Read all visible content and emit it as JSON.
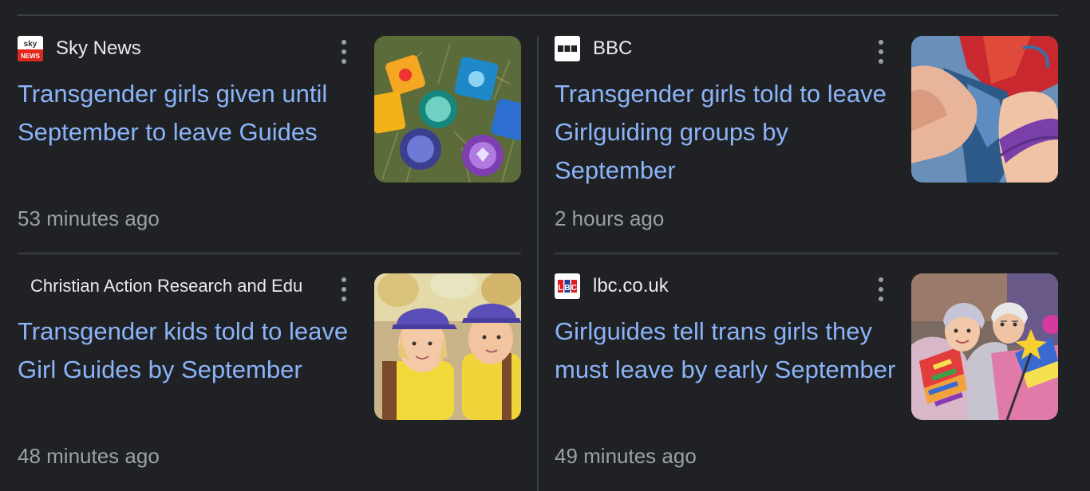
{
  "articles": [
    {
      "source": "Sky News",
      "favicon": "sky-news-icon",
      "headline": "Transgender girls given until September to leave Guides",
      "time": "53 minutes ago",
      "thumbnail": "guide-badges-on-grass"
    },
    {
      "source": "BBC",
      "favicon": "bbc-icon",
      "headline": "Transgender girls told to leave Girlguiding groups by September",
      "time": "2 hours ago",
      "thumbnail": "hands-tying-neckerchief"
    },
    {
      "source": "Christian Action Research and Edu",
      "favicon": "",
      "headline": "Transgender kids told to leave Girl Guides by September",
      "time": "48 minutes ago",
      "thumbnail": "brownies-in-purple-caps"
    },
    {
      "source": "lbc.co.uk",
      "favicon": "lbc-icon",
      "headline": "Girlguides tell trans girls they must leave by early September",
      "time": "49 minutes ago",
      "thumbnail": "pride-flags-crowd"
    }
  ],
  "colors": {
    "background": "#202124",
    "headline": "#8ab4f8",
    "source": "#e8eaed",
    "time": "#9aa0a6",
    "divider": "#3c4043"
  }
}
